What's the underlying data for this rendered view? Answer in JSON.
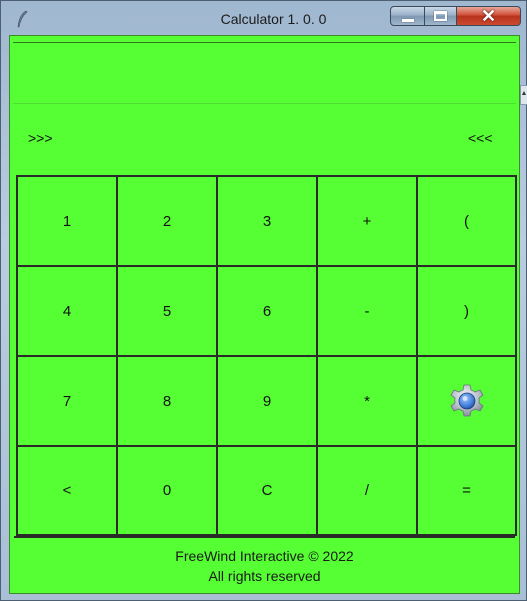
{
  "window": {
    "title": "Calculator 1. 0. 0",
    "close_glyph": "✕",
    "icons": [
      "feather-icon",
      "minimize-icon",
      "maximize-icon",
      "close-icon"
    ]
  },
  "display": {
    "value": ""
  },
  "nav": {
    "left_label": ">>>",
    "right_label": "<<<"
  },
  "keys": [
    [
      "1",
      "2",
      "3",
      "+",
      "("
    ],
    [
      "4",
      "5",
      "6",
      "-",
      ")"
    ],
    [
      "7",
      "8",
      "9",
      "*",
      "gear-icon"
    ],
    [
      "<",
      "0",
      "C",
      "/",
      "="
    ]
  ],
  "footer": {
    "line1": "FreeWind Interactive © 2022",
    "line2": "All rights reserved"
  },
  "colors": {
    "background": "#55ff33",
    "border": "#2a2a2a",
    "gear": "#3f7ad6"
  }
}
